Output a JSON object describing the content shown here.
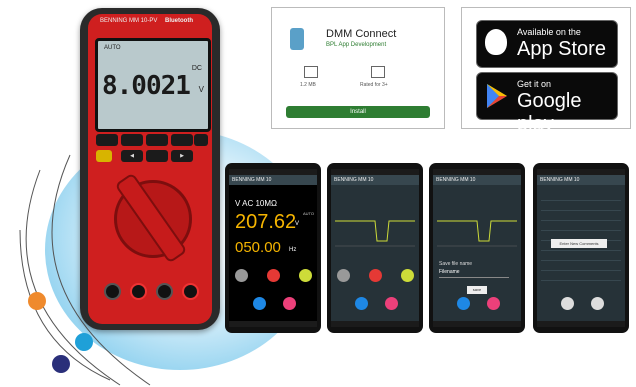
{
  "meter": {
    "model": "BENNING MM 10-PV",
    "bluetooth": "Bluetooth",
    "auto": "AUTO",
    "mode": "DC",
    "reading": "8.0021",
    "unit": "V"
  },
  "store_card": {
    "app_name": "DMM Connect",
    "developer": "BPL App Development",
    "size": "1.2 MB",
    "rating": "Rated for 3+",
    "install_label": "Install"
  },
  "badges": {
    "app_store_small": "Available on the",
    "app_store_big": "App Store",
    "google_small": "Get it on",
    "google_big": "Google play"
  },
  "phones": [
    {
      "title": "BENNING MM 10",
      "mode": "V AC 10MΩ",
      "value": "207.62",
      "unit": "V",
      "auto": "AUTO",
      "sub": "050.00",
      "subunit": "Hz"
    },
    {
      "title": "BENNING MM 10"
    },
    {
      "title": "BENNING MM 10",
      "file_label": "Save file name",
      "file_value": "Filename",
      "ok": "save"
    },
    {
      "title": "BENNING MM 10",
      "tooltip": "Enter New Comments"
    }
  ],
  "colors": {
    "meter_red": "#cf1f1f",
    "orange_dot": "#ef8a2d",
    "cyan_dot": "#1fa0d8",
    "navy_dot": "#2a2f7a",
    "blob": "#bfe6f7"
  }
}
